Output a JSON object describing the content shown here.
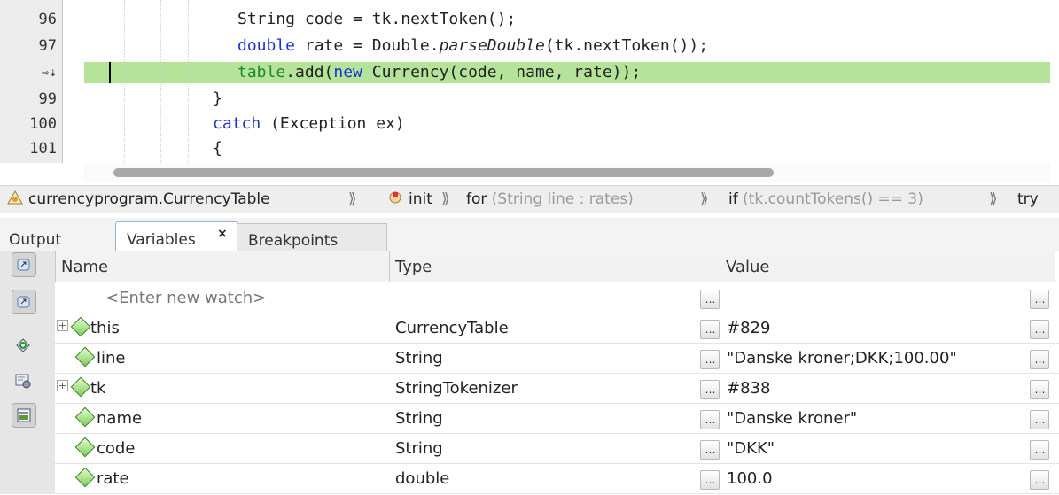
{
  "editor": {
    "lines": [
      {
        "num": "96",
        "code": "String code = tk.nextToken();"
      },
      {
        "num": "97",
        "kw": "double",
        "rest1": " rate = Double.",
        "it": "parseDouble",
        "rest2": "(tk.nextToken());"
      },
      {
        "num": "⇨⇣",
        "fld": "table",
        "rest1": ".add(",
        "kw": "new",
        "rest2": " Currency(code, name, rate));"
      },
      {
        "num": "99",
        "code": "}"
      },
      {
        "num": "100",
        "kw": "catch",
        "rest": " (Exception ex)"
      },
      {
        "num": "101",
        "code": "{"
      }
    ],
    "highlight_color": "#b5e39a"
  },
  "breadcrumb": {
    "items": [
      {
        "icon": "class-icon",
        "text": "currencyprogram.CurrencyTable",
        "grey": ""
      },
      {
        "icon": "constructor-icon",
        "text": "init",
        "grey": ""
      },
      {
        "icon": "",
        "text": "for",
        "grey": " (String line : rates)"
      },
      {
        "icon": "",
        "text": "if",
        "grey": " (tk.countTokens() == 3)"
      },
      {
        "icon": "",
        "text": "try",
        "grey": ""
      }
    ],
    "separator": "⟫"
  },
  "tabs": {
    "output": "Output",
    "variables": "Variables",
    "close": "×",
    "breakpoints": "Breakpoints"
  },
  "toolbar": [
    "watch-icon",
    "debugger-icon",
    "add-watch-icon",
    "settings-icon",
    "show-source-icon"
  ],
  "table": {
    "columns": [
      "Name",
      "Type",
      "Value"
    ],
    "watch_placeholder": "<Enter new watch>",
    "ellipsis": "…",
    "rows": [
      {
        "name": "this",
        "type": "CurrencyTable",
        "value": "#829",
        "expandable": true
      },
      {
        "name": "line",
        "type": "String",
        "value": "\"Danske kroner;DKK;100.00\"",
        "expandable": false
      },
      {
        "name": "tk",
        "type": "StringTokenizer",
        "value": "#838",
        "expandable": true
      },
      {
        "name": "name",
        "type": "String",
        "value": "\"Danske kroner\"",
        "expandable": false
      },
      {
        "name": "code",
        "type": "String",
        "value": "\"DKK\"",
        "expandable": false
      },
      {
        "name": "rate",
        "type": "double",
        "value": "100.0",
        "expandable": false
      }
    ]
  },
  "colors": {
    "keyword": "#1a32d6",
    "field": "#1a8a2a",
    "variable_icon": "#7fcf58"
  }
}
